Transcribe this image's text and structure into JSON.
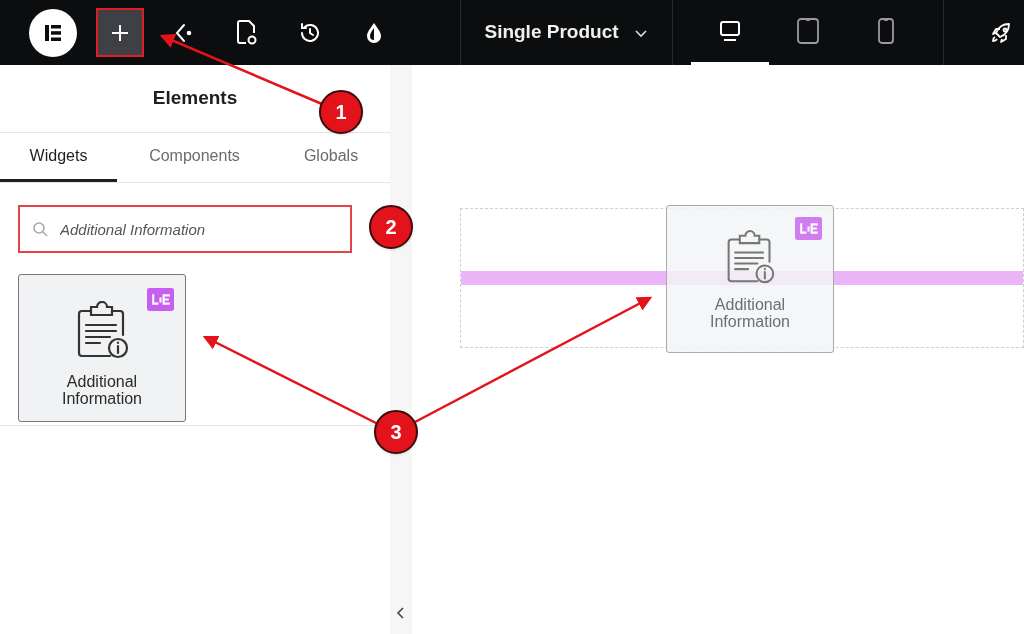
{
  "topbar": {
    "template": "Single Product",
    "devices": [
      {
        "kind": "desktop",
        "selected": true
      },
      {
        "kind": "tablet",
        "selected": false
      },
      {
        "kind": "mobile",
        "selected": false
      }
    ]
  },
  "panel": {
    "title": "Elements",
    "tabs": [
      {
        "label": "Widgets",
        "selected": true
      },
      {
        "label": "Components",
        "selected": false
      },
      {
        "label": "Globals",
        "selected": false
      }
    ],
    "search": {
      "value": "Additional Information"
    },
    "widgets": [
      {
        "label": "Additional Information"
      }
    ]
  },
  "canvas": {
    "dragged_widget": {
      "label": "Additional Information"
    }
  },
  "annotations": [
    {
      "number": "1"
    },
    {
      "number": "2"
    },
    {
      "number": "3"
    }
  ]
}
